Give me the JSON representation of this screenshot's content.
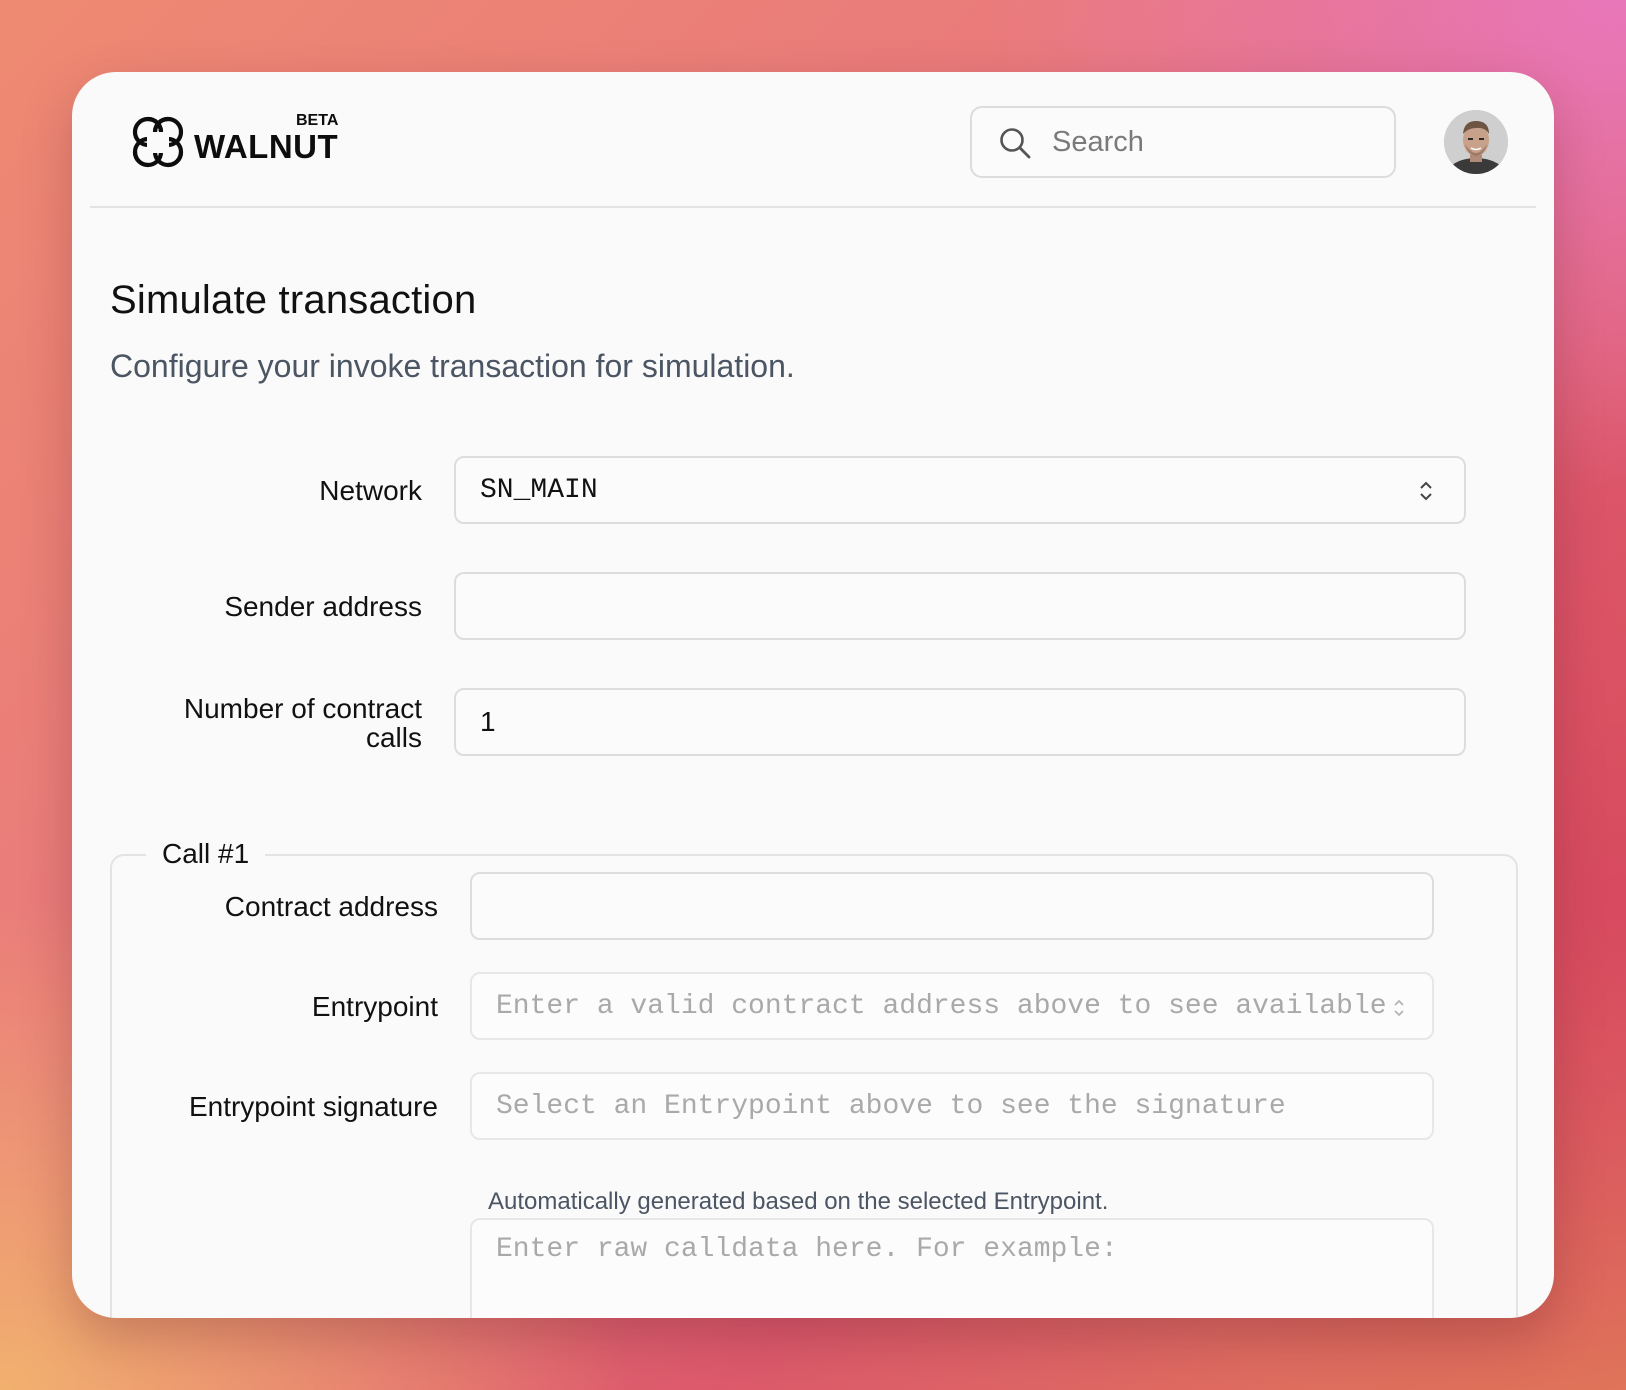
{
  "header": {
    "logo_text": "WALNUT",
    "logo_badge": "BETA",
    "search_placeholder": "Search"
  },
  "page": {
    "title": "Simulate transaction",
    "subtitle": "Configure your invoke transaction for simulation."
  },
  "form": {
    "network": {
      "label": "Network",
      "value": "SN_MAIN"
    },
    "sender_address": {
      "label": "Sender address",
      "value": ""
    },
    "num_calls": {
      "label_line1": "Number of contract",
      "label_line2": "calls",
      "value": "1"
    },
    "call": {
      "legend": "Call #1",
      "contract_address": {
        "label": "Contract address",
        "value": ""
      },
      "entrypoint": {
        "label": "Entrypoint",
        "placeholder": "Enter a valid contract address above to see available e"
      },
      "entrypoint_signature": {
        "label": "Entrypoint signature",
        "placeholder": "Select an Entrypoint above to see the signature",
        "hint": "Automatically generated based on the selected Entrypoint."
      },
      "calldata": {
        "placeholder": "Enter raw calldata here. For example:"
      }
    }
  },
  "icons": {
    "search": "search-icon",
    "select": "chevron-updown-icon",
    "logo": "walnut-logo-icon",
    "avatar": "user-avatar"
  },
  "colors": {
    "window_bg": "#fafafa",
    "border": "#dddddd",
    "muted_text": "#4b5563"
  }
}
